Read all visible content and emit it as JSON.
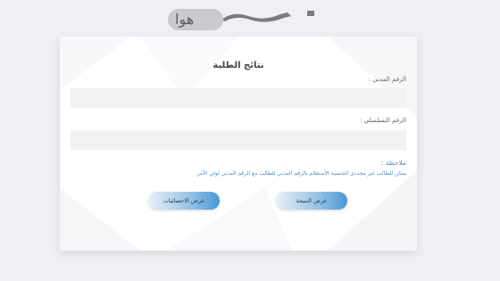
{
  "logo": {
    "text": "هوا"
  },
  "form": {
    "title": "نتائج الطلبة",
    "civil_id_label": "الرقم المدني :",
    "civil_id_value": "",
    "serial_label": "الرقم التسلسلي :",
    "serial_value": "",
    "note_title": "ملاحظة :",
    "note_text": "يمكن للطالب غير محددي الجنسية الأستعلام بالرقم المدني للطالب مع الرقم المدني لولي الأمر"
  },
  "buttons": {
    "show_result": "عرض النتيجة",
    "show_stats": "عرض الاحصائيات"
  },
  "colors": {
    "accent": "#4c8fc6",
    "button_end": "#4a98d6",
    "field_bg": "#f1f2f4"
  }
}
